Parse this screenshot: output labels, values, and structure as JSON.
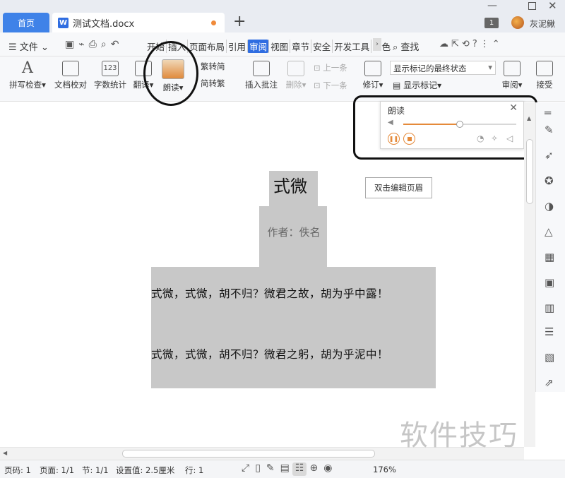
{
  "tabs": {
    "home": "首页",
    "doc": "测试文档.docx",
    "new_tab": "+"
  },
  "titlebar": {
    "badge_count": "1",
    "user_name": "灰泥鳅"
  },
  "menu": {
    "file": "文件",
    "tabs": [
      "开始",
      "插入",
      "页面布局",
      "引用",
      "审阅",
      "视图",
      "章节",
      "安全",
      "开发工具",
      "特色"
    ],
    "active_tab": "审阅",
    "search": "查找"
  },
  "ribbon": {
    "spell_check": "拼写检查",
    "doc_proof": "文档校对",
    "word_count": "字数统计",
    "translate": "翻译",
    "read_aloud": "朗读",
    "trad_to_simp": "繁转简",
    "simp_to_trad": "简转繁",
    "insert_comment": "插入批注",
    "delete": "删除",
    "prev": "上一条",
    "next": "下一条",
    "revise": "修订",
    "markup_select": "显示标记的最终状态",
    "show_markup": "显示标记",
    "review": "审阅",
    "accept": "接受"
  },
  "read_popup": {
    "title": "朗读",
    "volume_level": 0.5
  },
  "document": {
    "header_hint": "双击编辑页眉",
    "title": "式微",
    "author": "作者：佚名",
    "lines": [
      "式微，式微，胡不归？微君之故，胡为乎中露！",
      "式微，式微，胡不归？微君之躬，胡为乎泥中！"
    ]
  },
  "status": {
    "page": "页码: 1",
    "pages": "页面: 1/1",
    "section": "节: 1/1",
    "setting": "设置值: 2.5厘米",
    "row": "行: 1",
    "zoom": "176%"
  },
  "watermark": "软件技巧"
}
